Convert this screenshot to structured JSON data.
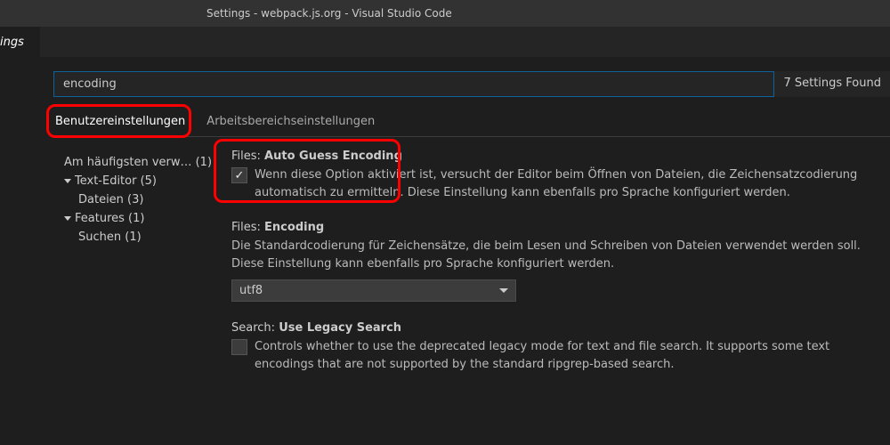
{
  "titlebar": "Settings - webpack.js.org - Visual Studio Code",
  "editorTab": "ings",
  "search": {
    "value": "encoding",
    "result": "7 Settings Found"
  },
  "tabs": {
    "user": "Benutzereinstellungen",
    "workspace": "Arbeitsbereichseinstellungen"
  },
  "sidebar": {
    "frequent": "Am häufigsten verw…  (1)",
    "textEditor": "Text-Editor (5)",
    "files": "Dateien (3)",
    "features": "Features (1)",
    "search": "Suchen (1)"
  },
  "settings": {
    "autoGuess": {
      "prefix": "Files: ",
      "name": "Auto Guess Encoding",
      "desc": "Wenn diese Option aktiviert ist, versucht der Editor beim Öffnen von Dateien, die Zeichensatzcodierung automatisch zu ermitteln. Diese Einstellung kann ebenfalls pro Sprache konfiguriert werden.",
      "checked": "✓"
    },
    "encoding": {
      "prefix": "Files: ",
      "name": "Encoding",
      "desc": "Die Standardcodierung für Zeichensätze, die beim Lesen und Schreiben von Dateien verwendet werden soll. Diese Einstellung kann ebenfalls pro Sprache konfiguriert werden.",
      "value": "utf8"
    },
    "legacy": {
      "prefix": "Search: ",
      "name": "Use Legacy Search",
      "desc": "Controls whether to use the deprecated legacy mode for text and file search. It supports some text encodings that are not supported by the standard ripgrep-based search."
    }
  }
}
